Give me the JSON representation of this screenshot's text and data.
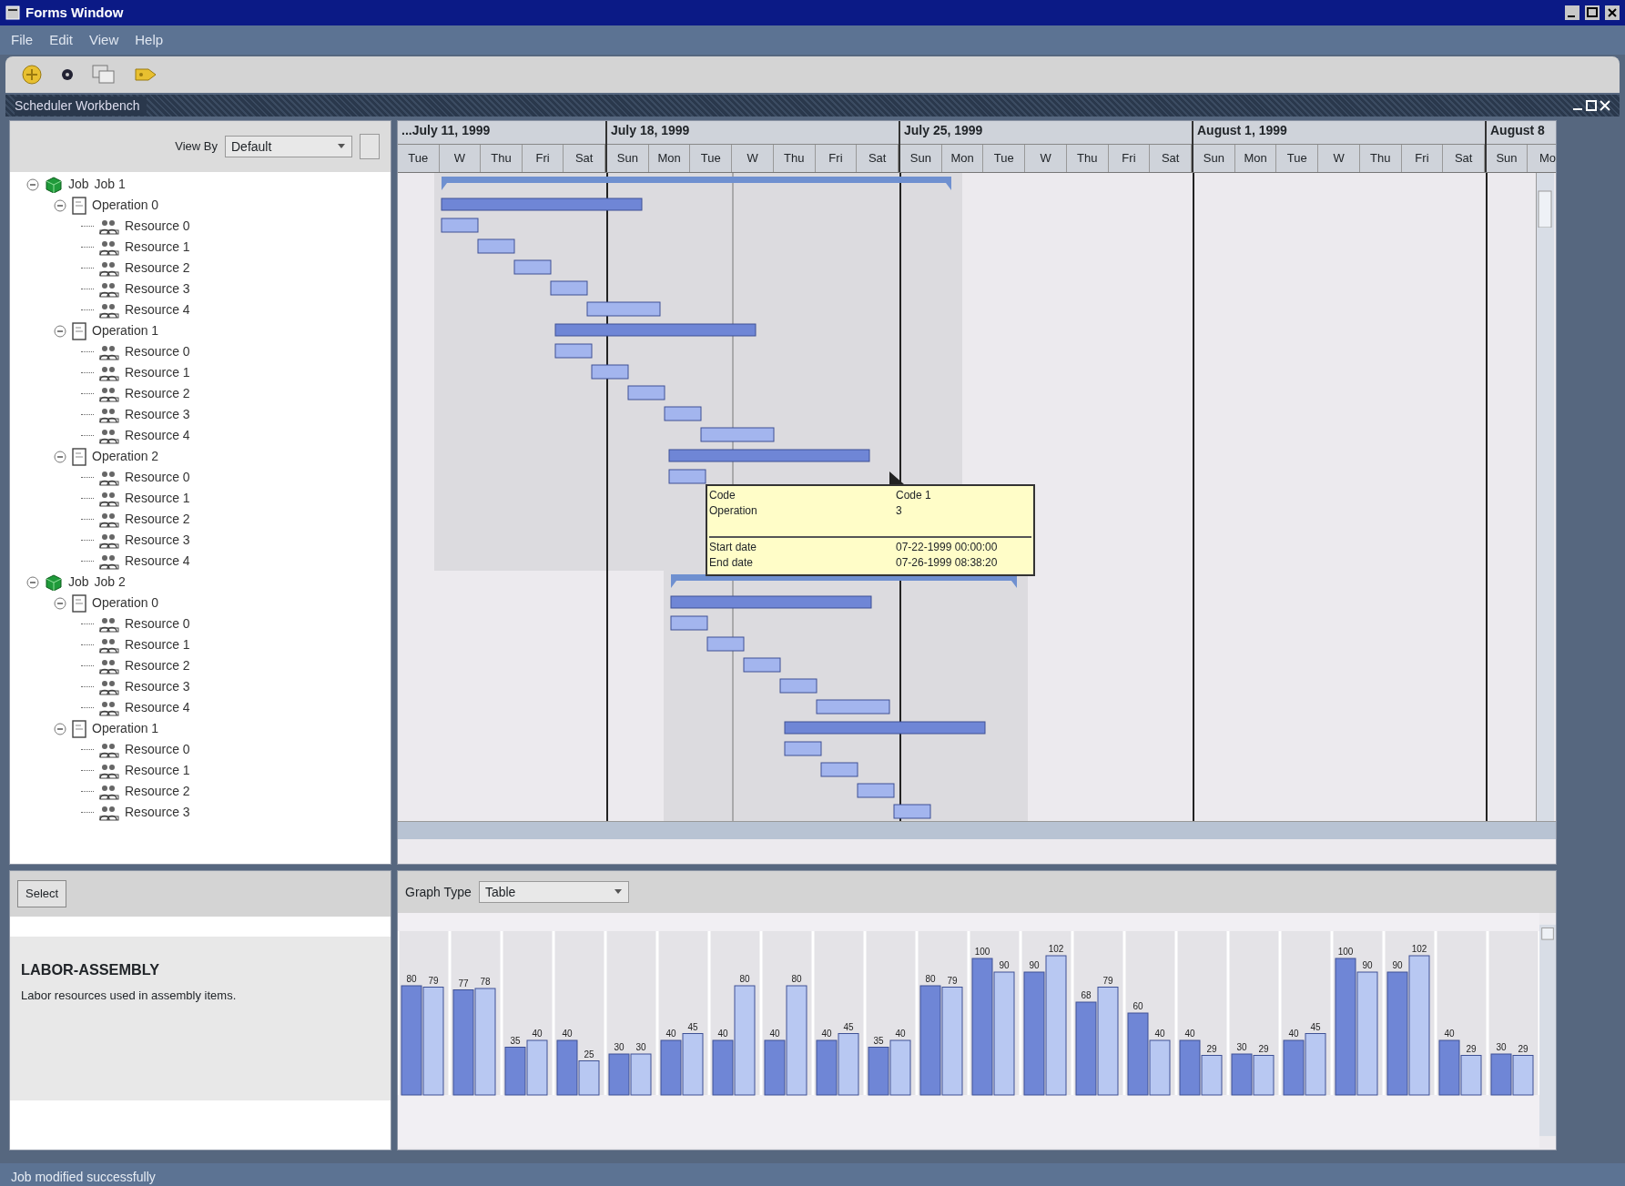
{
  "window": {
    "title": "Forms Window"
  },
  "menu": [
    "File",
    "Edit",
    "View",
    "Help"
  ],
  "workbench": {
    "title": "Scheduler Workbench"
  },
  "view_by": {
    "label": "View By",
    "value": "Default"
  },
  "tree": [
    {
      "kind": "job",
      "label": "Job",
      "name": "Job 1",
      "expanded": true,
      "children": [
        {
          "kind": "operation",
          "label": "Operation 0",
          "expanded": true,
          "children": [
            {
              "kind": "resource",
              "label": "Resource 0"
            },
            {
              "kind": "resource",
              "label": "Resource 1"
            },
            {
              "kind": "resource",
              "label": "Resource 2"
            },
            {
              "kind": "resource",
              "label": "Resource 3"
            },
            {
              "kind": "resource",
              "label": "Resource 4"
            }
          ]
        },
        {
          "kind": "operation",
          "label": "Operation 1",
          "expanded": true,
          "children": [
            {
              "kind": "resource",
              "label": "Resource 0"
            },
            {
              "kind": "resource",
              "label": "Resource 1"
            },
            {
              "kind": "resource",
              "label": "Resource 2"
            },
            {
              "kind": "resource",
              "label": "Resource 3"
            },
            {
              "kind": "resource",
              "label": "Resource 4"
            }
          ]
        },
        {
          "kind": "operation",
          "label": "Operation 2",
          "expanded": true,
          "children": [
            {
              "kind": "resource",
              "label": "Resource 0"
            },
            {
              "kind": "resource",
              "label": "Resource 1"
            },
            {
              "kind": "resource",
              "label": "Resource 2"
            },
            {
              "kind": "resource",
              "label": "Resource 3"
            },
            {
              "kind": "resource",
              "label": "Resource 4"
            }
          ]
        }
      ]
    },
    {
      "kind": "job",
      "label": "Job",
      "name": "Job 2",
      "expanded": true,
      "children": [
        {
          "kind": "operation",
          "label": "Operation 0",
          "expanded": true,
          "children": [
            {
              "kind": "resource",
              "label": "Resource 0"
            },
            {
              "kind": "resource",
              "label": "Resource 1"
            },
            {
              "kind": "resource",
              "label": "Resource 2"
            },
            {
              "kind": "resource",
              "label": "Resource 3"
            },
            {
              "kind": "resource",
              "label": "Resource 4"
            }
          ]
        },
        {
          "kind": "operation",
          "label": "Operation 1",
          "expanded": true,
          "children": [
            {
              "kind": "resource",
              "label": "Resource 0"
            },
            {
              "kind": "resource",
              "label": "Resource 1"
            },
            {
              "kind": "resource",
              "label": "Resource 2"
            },
            {
              "kind": "resource",
              "label": "Resource 3"
            }
          ]
        }
      ]
    }
  ],
  "timeline": {
    "weeks": [
      {
        "label": "...July 11, 1999",
        "days": [
          "Tue",
          "W",
          "Thu",
          "Fri",
          "Sat"
        ]
      },
      {
        "label": "July 18, 1999",
        "days": [
          "Sun",
          "Mon",
          "Tue",
          "W",
          "Thu",
          "Fri",
          "Sat"
        ]
      },
      {
        "label": "July 25, 1999",
        "days": [
          "Sun",
          "Mon",
          "Tue",
          "W",
          "Thu",
          "Fri",
          "Sat"
        ]
      },
      {
        "label": "August 1, 1999",
        "days": [
          "Sun",
          "Mon",
          "Tue",
          "W",
          "Thu",
          "Fri",
          "Sat"
        ]
      },
      {
        "label": "August 8",
        "days": [
          "Sun",
          "Mo"
        ]
      }
    ]
  },
  "tooltip": {
    "sections": [
      [
        {
          "label": "Code",
          "value": "Code 1"
        },
        {
          "label": "Operation",
          "value": "3"
        }
      ],
      [
        {
          "label": "Start date",
          "value": "07-22-1999 00:00:00"
        },
        {
          "label": "End date",
          "value": "07-26-1999 08:38:20"
        }
      ]
    ]
  },
  "select_button": "Select",
  "resource_info": {
    "title": "LABOR-ASSEMBLY",
    "description": "Labor resources used in assembly items."
  },
  "graph_type": {
    "label": "Graph Type",
    "value": "Table"
  },
  "chart_data": {
    "type": "bar",
    "data_labels": true,
    "series": [
      {
        "color": "#6f86d6",
        "values": [
          80,
          77,
          35,
          40,
          30,
          40,
          40,
          40,
          40,
          35,
          80,
          100,
          90,
          68,
          60,
          40,
          30,
          40,
          100,
          90,
          40,
          30
        ]
      },
      {
        "color": "#b8c8f2",
        "values": [
          79,
          78,
          40,
          25,
          30,
          45,
          80,
          80,
          45,
          40,
          79,
          90,
          102,
          79,
          40,
          29,
          29,
          45,
          90,
          102,
          29,
          29
        ]
      }
    ]
  },
  "status_bar": "Job modified successfully"
}
